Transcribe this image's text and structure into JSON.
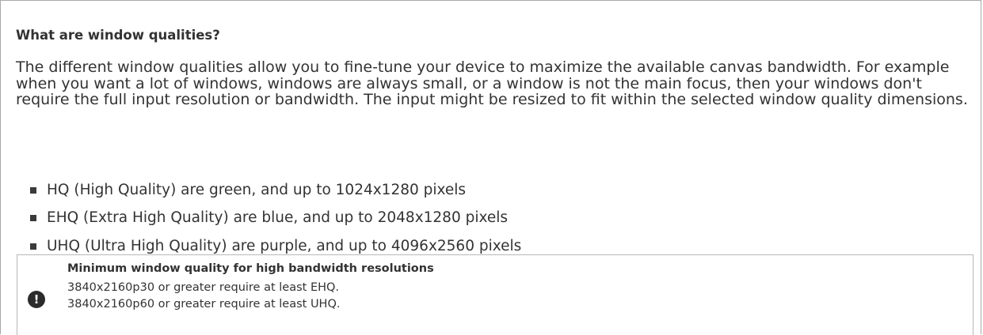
{
  "section": {
    "heading": "What are window qualities?",
    "intro": "The different window qualities allow you to fine-tune your device to maximize the available canvas bandwidth. For example when you want a lot of windows, windows are always small, or a window is not the main focus, then your windows don't require the full input resolution or bandwidth. The input might be resized to fit within the selected window quality dimensions.",
    "qualities": [
      "HQ (High Quality) are green, and up to 1024x1280 pixels",
      "EHQ (Extra High Quality) are blue, and up to 2048x1280 pixels",
      "UHQ (Ultra High Quality) are purple, and up to 4096x2560 pixels"
    ]
  },
  "notice": {
    "icon": "exclamation-icon",
    "title": "Minimum window quality for high bandwidth resolutions",
    "lines": [
      "3840x2160p30 or greater require at least EHQ.",
      "3840x2160p60 or greater require at least UHQ."
    ]
  }
}
